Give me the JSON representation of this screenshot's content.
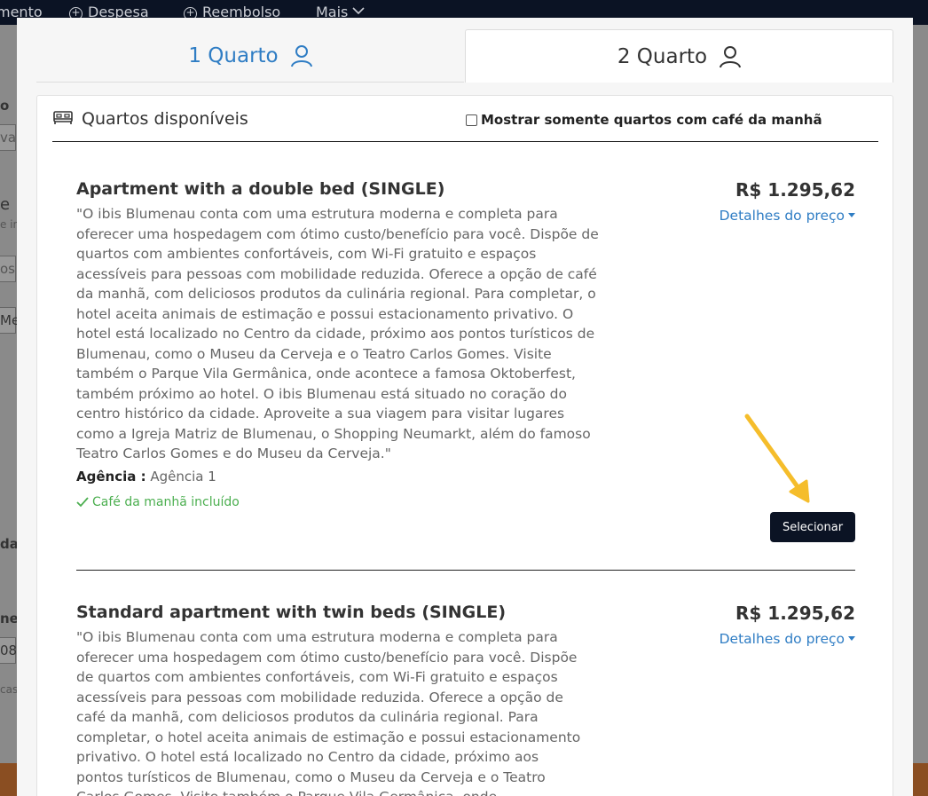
{
  "background": {
    "nav": [
      {
        "label": "mento",
        "icon": ""
      },
      {
        "label": "Despesa",
        "icon": "plus-circle-icon"
      },
      {
        "label": "Reembolso",
        "icon": "plus-circle-icon"
      },
      {
        "label": "Mais",
        "icon": "chevron-down-icon"
      }
    ],
    "fragments": [
      "o",
      "va",
      "e",
      "e in",
      "os",
      "Me",
      "da",
      "ne",
      "08,",
      "cas"
    ]
  },
  "tabs": [
    {
      "label": "1 Quarto",
      "icon": "user-icon",
      "active": false
    },
    {
      "label": "2 Quarto",
      "icon": "user-icon",
      "active": true
    }
  ],
  "panel": {
    "title": "Quartos disponíveis",
    "filter_label": "Mostrar somente quartos com café da manhã"
  },
  "rooms": [
    {
      "name": "Apartment with a double bed (SINGLE)",
      "description": "\"O ibis Blumenau conta com uma estrutura moderna e completa para oferecer uma hospedagem com ótimo custo/benefício para você. Dispõe de quartos com ambientes confortáveis, com Wi-Fi gratuito e espaços acessíveis para pessoas com mobilidade reduzida. Oferece a opção de café da manhã, com deliciosos produtos da culinária regional. Para completar, o hotel aceita animais de estimação e possui estacionamento privativo. O hotel está localizado no Centro da cidade, próximo aos pontos turísticos de Blumenau, como o Museu da Cerveja e o Teatro Carlos Gomes. Visite também o Parque Vila Germânica, onde acontece a famosa Oktoberfest, também próximo ao hotel. O ibis Blumenau está situado no coração do centro histórico da cidade. Aproveite a sua viagem para visitar lugares como a Igreja Matriz de Blumenau, o Shopping Neumarkt, além do famoso Teatro Carlos Gomes e do Museu da Cerveja.\"",
      "price": "R$ 1.295,62",
      "price_details": "Detalhes do preço",
      "agency_label": "Agência :",
      "agency": "Agência 1",
      "breakfast": "Café da manhã incluído",
      "select_label": "Selecionar"
    },
    {
      "name": "Standard apartment with twin beds (SINGLE)",
      "description": "\"O ibis Blumenau conta com uma estrutura moderna e completa para oferecer uma hospedagem com ótimo custo/benefício para você. Dispõe de quartos com ambientes confortáveis, com Wi-Fi gratuito e espaços acessíveis para pessoas com mobilidade reduzida. Oferece a opção de café da manhã, com deliciosos produtos da culinária regional. Para completar, o hotel aceita animais de estimação e possui estacionamento privativo. O hotel está localizado no Centro da cidade, próximo aos pontos turísticos de Blumenau, como o Museu da Cerveja e o Teatro Carlos Gomes. Visite também o Parque Vila Germânica, onde",
      "price": "R$ 1.295,62",
      "price_details": "Detalhes do preço"
    }
  ],
  "colors": {
    "accent": "#2f7dc4",
    "nav_dark": "#0b1324",
    "success": "#4caf50",
    "annotation_arrow": "#f5bd2b"
  }
}
